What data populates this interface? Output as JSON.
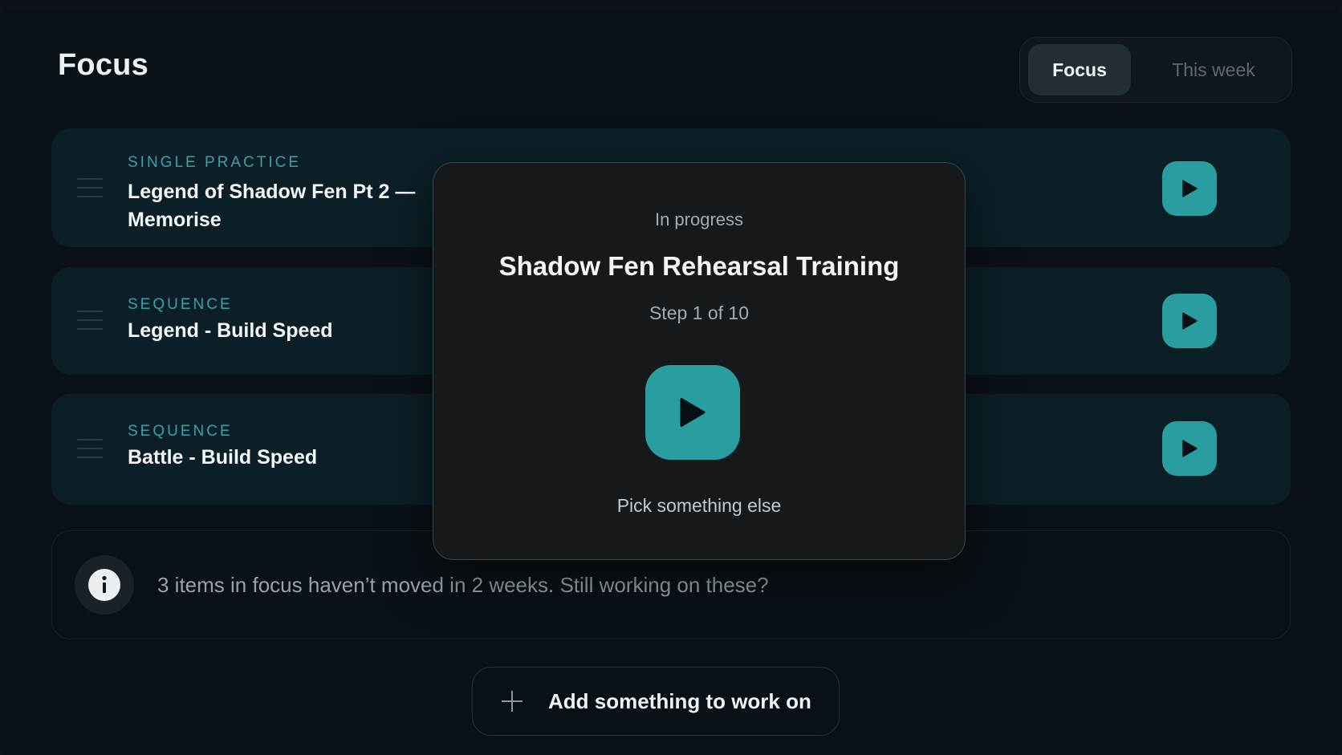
{
  "header": {
    "title": "Focus",
    "tabs": [
      {
        "label": "Focus",
        "active": true
      },
      {
        "label": "This week",
        "active": false
      }
    ]
  },
  "items": [
    {
      "kind": "SINGLE PRACTICE",
      "title": "Legend of Shadow Fen Pt 2 — Memorise",
      "action_icon": "play-icon"
    },
    {
      "kind": "SEQUENCE",
      "title": "Legend - Build Speed",
      "action_icon": "play-icon"
    },
    {
      "kind": "SEQUENCE",
      "title": "Battle - Build Speed",
      "action_icon": "play-icon"
    }
  ],
  "notice": {
    "icon": "info-icon",
    "text": "3 items in focus haven’t moved in 2 weeks. Still working on these?"
  },
  "add_button": {
    "icon": "plus-icon",
    "label": "Add something to work on"
  },
  "modal": {
    "status": "In progress",
    "title": "Shadow Fen Rehearsal Training",
    "step": "Step 1 of 10",
    "play_icon": "play-icon",
    "alternate_label": "Pick something else"
  },
  "colors": {
    "accent": "#2a9da1",
    "kind_label": "#38a3a6",
    "background": "#0a1116",
    "row_background": "#0c1f27",
    "modal_background": "#16191c"
  }
}
